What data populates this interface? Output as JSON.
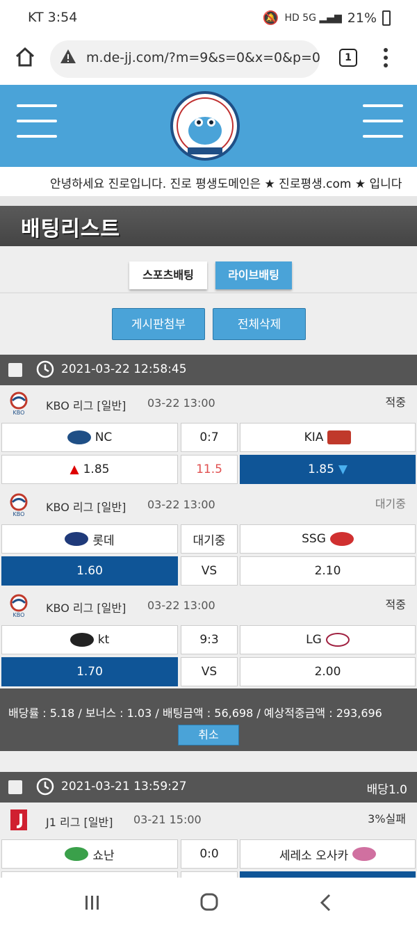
{
  "status_bar": {
    "carrier_time": "KT 3:54",
    "battery": "21%"
  },
  "browser": {
    "url": "m.de-jj.com/?m=9&s=0&x=0&p=0",
    "tab_count": "1"
  },
  "marquee": "안녕하세요 진로입니다. 진로 평생도메인은 ★ 진로평생.com ★ 입니다",
  "page_title": "배팅리스트",
  "tabs": {
    "sports": "스포츠배팅",
    "live": "라이브배팅"
  },
  "buttons": {
    "attach": "게시판첨부",
    "delete_all": "전체삭제",
    "cancel": "취소"
  },
  "slip1": {
    "datetime": "2021-03-22 12:58:45",
    "games": [
      {
        "league": "KBO 리그 [일반]",
        "time": "03-22 13:00",
        "status": "적중",
        "home": "NC",
        "score": "0:7",
        "away": "KIA",
        "home_odds": "1.85",
        "mid": "11.5",
        "away_odds": "1.85"
      },
      {
        "league": "KBO 리그 [일반]",
        "time": "03-22 13:00",
        "status": "대기중",
        "home": "롯데",
        "score": "대기중",
        "away": "SSG",
        "home_odds": "1.60",
        "mid": "VS",
        "away_odds": "2.10"
      },
      {
        "league": "KBO 리그 [일반]",
        "time": "03-22 13:00",
        "status": "적중",
        "home": "kt",
        "score": "9:3",
        "away": "LG",
        "home_odds": "1.70",
        "mid": "VS",
        "away_odds": "2.00"
      }
    ],
    "summary": "배당률 : 5.18 / 보너스 : 1.03 / 배팅금액 : 56,698 / 예상적중금액 : 293,696"
  },
  "slip2": {
    "datetime": "2021-03-21 13:59:27",
    "rate": "배당1.0",
    "game": {
      "league": "J1 리그 [일반]",
      "time": "03-21 15:00",
      "status": "3%실패",
      "home": "쇼난",
      "score": "0:0",
      "away": "세레소 오사카"
    }
  },
  "colors": {
    "accent": "#4aa3d8",
    "selected": "#0f5597",
    "bar": "#555555"
  }
}
